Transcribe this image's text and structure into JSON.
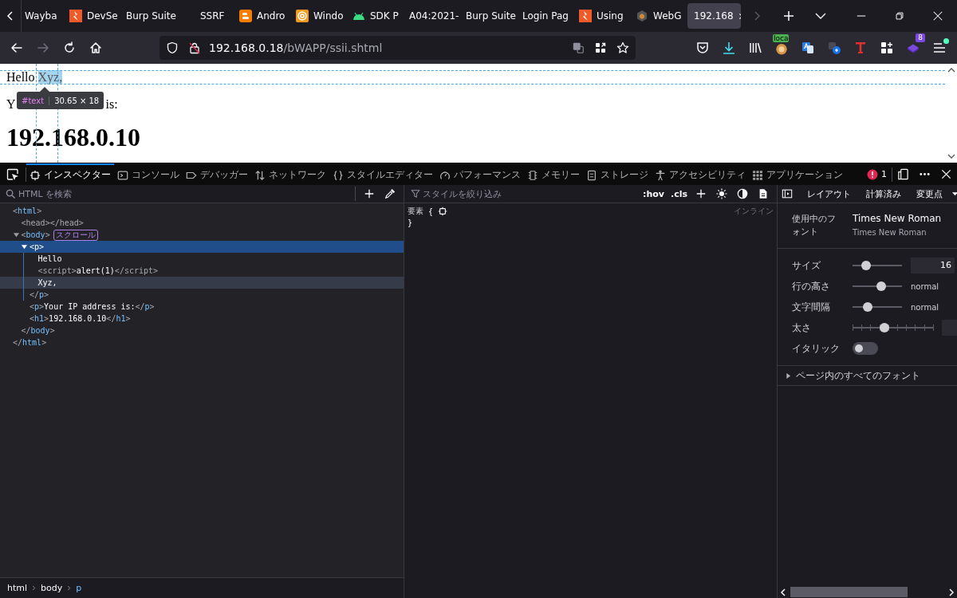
{
  "browser": {
    "tabs": [
      {
        "title": "Wayba",
        "kind": "plain",
        "selected": false
      },
      {
        "title": "DevSe",
        "kind": "bolt",
        "selected": false
      },
      {
        "title": "Burp Suite",
        "kind": "plain",
        "selected": false
      },
      {
        "title": "SSRF",
        "kind": "blank",
        "selected": false
      },
      {
        "title": "Andro",
        "kind": "blogger",
        "selected": false
      },
      {
        "title": "Windo",
        "kind": "at",
        "selected": false
      },
      {
        "title": "SDK P",
        "kind": "android",
        "selected": false
      },
      {
        "title": "A04:2021-",
        "kind": "plain",
        "selected": false
      },
      {
        "title": "Burp Suite",
        "kind": "plain",
        "selected": false
      },
      {
        "title": "Login Pag",
        "kind": "plain",
        "selected": false
      },
      {
        "title": "Using",
        "kind": "bolt",
        "selected": false
      },
      {
        "title": "WebG",
        "kind": "cube",
        "selected": false
      },
      {
        "title": "192.168",
        "kind": "plain",
        "selected": true
      }
    ],
    "nav": [
      {
        "kind": "back",
        "disabled": false
      },
      {
        "kind": "forward",
        "disabled": true
      },
      {
        "kind": "reload",
        "disabled": false
      },
      {
        "kind": "home",
        "disabled": false
      }
    ],
    "url": {
      "host": "192.168.0.18",
      "path": "/bWAPP/ssii.shtml",
      "insecure": true
    },
    "toolbar": [
      {
        "kind": "pocket"
      },
      {
        "kind": "download"
      },
      {
        "kind": "library"
      },
      {
        "kind": "extension",
        "badge": "loca"
      },
      {
        "kind": "translate"
      },
      {
        "kind": "translate-jp"
      },
      {
        "kind": "letter-t"
      },
      {
        "kind": "extensions"
      },
      {
        "kind": "layers",
        "badge": "8"
      },
      {
        "kind": "menu",
        "notify": true
      }
    ]
  },
  "page": {
    "line1": [
      {
        "text": "Hello",
        "highlighted": false
      },
      {
        "text": "Xyz,",
        "highlighted": true
      }
    ],
    "line2": [
      "Y",
      "is:"
    ],
    "heading": "192.168.0.10",
    "tooltip": {
      "node": "#text",
      "size": "30.65 × 18"
    }
  },
  "devtools": {
    "tabs": [
      {
        "label": "インスペクター",
        "kind": "inspector",
        "selected": true
      },
      {
        "label": "コンソール",
        "kind": "console",
        "selected": false
      },
      {
        "label": "デバッガー",
        "kind": "debugger",
        "selected": false
      },
      {
        "label": "ネットワーク",
        "kind": "network",
        "selected": false
      },
      {
        "label": "スタイルエディター",
        "kind": "style",
        "selected": false
      },
      {
        "label": "パフォーマンス",
        "kind": "performance",
        "selected": false
      },
      {
        "label": "メモリー",
        "kind": "memory",
        "selected": false
      },
      {
        "label": "ストレージ",
        "kind": "storage",
        "selected": false
      },
      {
        "label": "アクセシビリティ",
        "kind": "accessibility",
        "selected": false
      },
      {
        "label": "アプリケーション",
        "kind": "application",
        "selected": false
      }
    ],
    "error_count": "1",
    "inspector": {
      "placeholder": "HTML を検索",
      "tree": [
        {
          "kind": "element",
          "open": "<html>",
          "close": "</html>",
          "selected": false,
          "hovered": false,
          "children": [
            {
              "kind": "element",
              "open": "<head></head>",
              "dimmed": true,
              "selected": false,
              "hovered": false
            },
            {
              "kind": "element",
              "open": "<body>",
              "close": "</body>",
              "badge": "スクロール",
              "expanded": true,
              "selected": false,
              "hovered": false,
              "children": [
                {
                  "kind": "element",
                  "open": "<p>",
                  "close": "</p>",
                  "expanded": true,
                  "selected": true,
                  "hovered": false,
                  "children": [
                    {
                      "kind": "text",
                      "text": "Hello",
                      "selected": false,
                      "hovered": false
                    },
                    {
                      "kind": "element",
                      "open": "<script>alert(1)</script>",
                      "dimmed": true,
                      "selected": false,
                      "hovered": false
                    },
                    {
                      "kind": "text",
                      "text": "Xyz,",
                      "selected": false,
                      "hovered": true
                    }
                  ]
                },
                {
                  "kind": "element",
                  "open": "<p>Your IP address is:</p>",
                  "selected": false,
                  "hovered": false
                },
                {
                  "kind": "element",
                  "open": "<h1>192.168.0.10</h1>",
                  "selected": false,
                  "hovered": false
                }
              ]
            }
          ]
        }
      ],
      "breadcrumbs": [
        {
          "label": "html",
          "selected": false
        },
        {
          "label": "body",
          "selected": false
        },
        {
          "label": "p",
          "selected": true
        }
      ]
    },
    "rules": {
      "placeholder": "スタイルを絞り込み",
      "toggles": [
        ":hov",
        ".cls"
      ],
      "rule": {
        "selector": "要素",
        "open": "{",
        "close": "}",
        "source": "インライン"
      }
    },
    "sidebar": {
      "tabs": [
        {
          "label": "レイアウト",
          "selected": false
        },
        {
          "label": "計算済み",
          "selected": false
        },
        {
          "label": "変更点",
          "selected": false
        }
      ],
      "fonts_label": "使用中のフォント",
      "font_name": "Times New Roman",
      "font_family": "Times New Roman",
      "sliders": [
        {
          "label": "サイズ",
          "kind": "field",
          "level": 0.27,
          "value": "16"
        },
        {
          "label": "行の高さ",
          "kind": "text",
          "level": 0.58,
          "value": "normal"
        },
        {
          "label": "文字間隔",
          "kind": "text",
          "level": 0.3,
          "value": "normal"
        },
        {
          "label": "太さ",
          "kind": "stepped",
          "level": 0.4
        }
      ],
      "italic": {
        "label": "イタリック",
        "on": false
      },
      "all_fonts": {
        "label": "ページ内のすべてのフォント",
        "expanded": false
      }
    }
  }
}
